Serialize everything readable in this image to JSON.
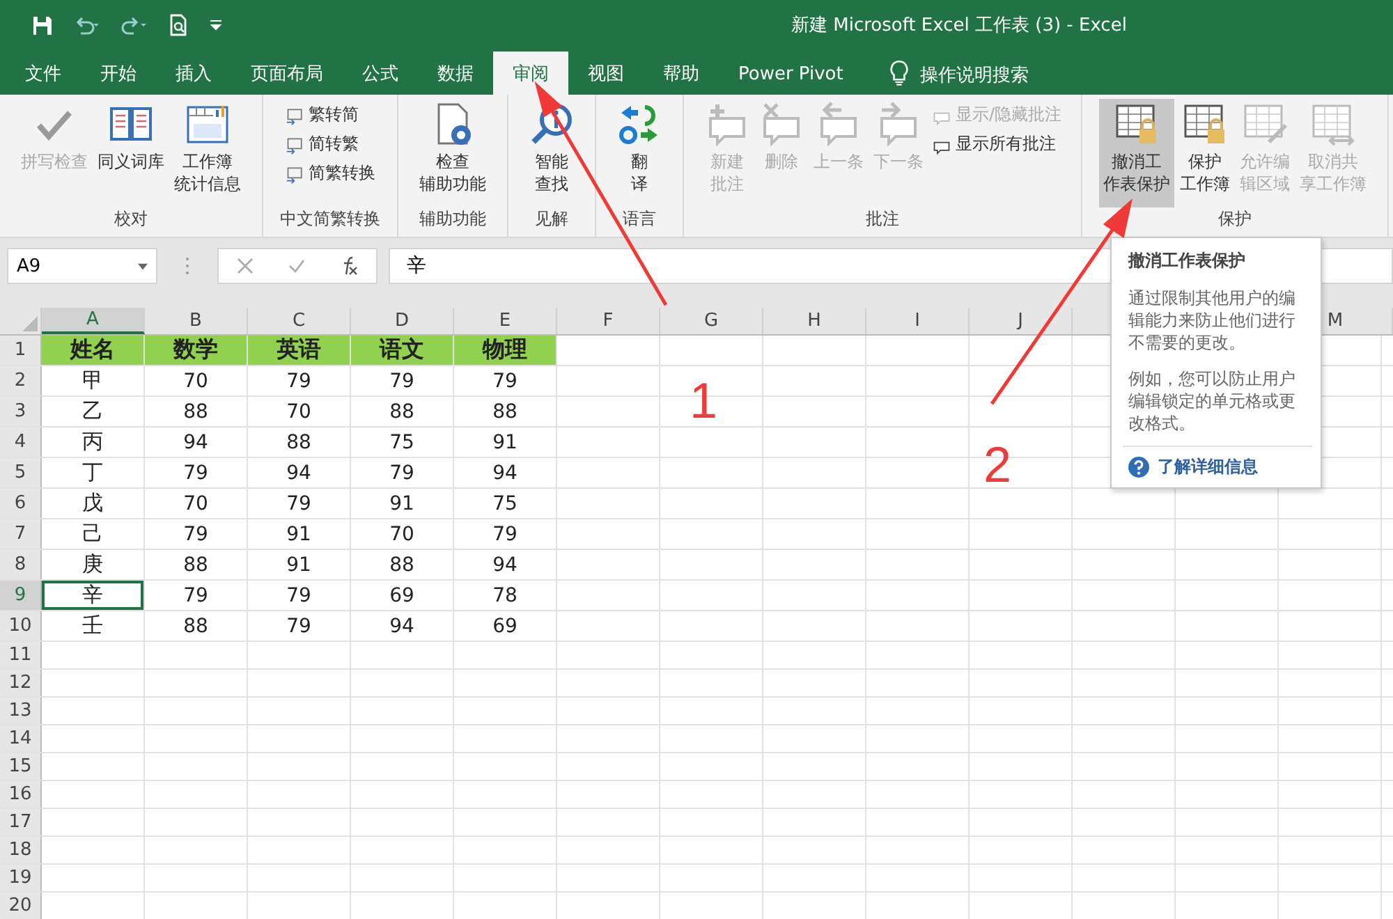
{
  "window": {
    "title": "新建 Microsoft Excel 工作表 (3)  -  Excel"
  },
  "tabs": [
    {
      "label": "文件",
      "selected": false
    },
    {
      "label": "开始",
      "selected": false
    },
    {
      "label": "插入",
      "selected": false
    },
    {
      "label": "页面布局",
      "selected": false
    },
    {
      "label": "公式",
      "selected": false
    },
    {
      "label": "数据",
      "selected": false
    },
    {
      "label": "审阅",
      "selected": true
    },
    {
      "label": "视图",
      "selected": false
    },
    {
      "label": "帮助",
      "selected": false
    },
    {
      "label": "Power Pivot",
      "selected": false
    }
  ],
  "tell_me": {
    "placeholder": "操作说明搜索"
  },
  "ribbon": {
    "groups": [
      {
        "label": "校对",
        "items": [
          {
            "kind": "large",
            "lines": [
              "拼写检查"
            ],
            "disabled": true,
            "highlighted": false
          },
          {
            "kind": "large",
            "lines": [
              "同义词库"
            ],
            "disabled": false,
            "highlighted": false
          },
          {
            "kind": "large",
            "lines": [
              "工作簿",
              "统计信息"
            ],
            "disabled": false,
            "highlighted": false
          }
        ]
      },
      {
        "label": "中文简繁转换",
        "items": [
          {
            "kind": "small",
            "lines": [
              "繁转简"
            ],
            "disabled": false,
            "highlighted": false
          },
          {
            "kind": "small",
            "lines": [
              "简转繁"
            ],
            "disabled": false,
            "highlighted": false
          },
          {
            "kind": "small",
            "lines": [
              "简繁转换"
            ],
            "disabled": false,
            "highlighted": false
          }
        ]
      },
      {
        "label": "辅助功能",
        "items": [
          {
            "kind": "large",
            "lines": [
              "检查",
              "辅助功能"
            ],
            "disabled": false,
            "highlighted": false
          }
        ]
      },
      {
        "label": "见解",
        "items": [
          {
            "kind": "large",
            "lines": [
              "智能",
              "查找"
            ],
            "disabled": false,
            "highlighted": false
          }
        ]
      },
      {
        "label": "语言",
        "items": [
          {
            "kind": "large",
            "lines": [
              "翻",
              "译"
            ],
            "disabled": false,
            "highlighted": false
          }
        ]
      },
      {
        "label": "批注",
        "items": [
          {
            "kind": "large",
            "lines": [
              "新建",
              "批注"
            ],
            "disabled": true,
            "highlighted": false
          },
          {
            "kind": "large",
            "lines": [
              "删除"
            ],
            "disabled": true,
            "highlighted": false
          },
          {
            "kind": "large",
            "lines": [
              "上一条"
            ],
            "disabled": true,
            "highlighted": false
          },
          {
            "kind": "large",
            "lines": [
              "下一条"
            ],
            "disabled": true,
            "highlighted": false
          },
          {
            "kind": "small",
            "lines": [
              "显示/隐藏批注"
            ],
            "disabled": true,
            "highlighted": false
          },
          {
            "kind": "small",
            "lines": [
              "显示所有批注"
            ],
            "disabled": false,
            "highlighted": false
          }
        ]
      },
      {
        "label": "保护",
        "items": [
          {
            "kind": "large",
            "lines": [
              "撤消工",
              "作表保护"
            ],
            "disabled": false,
            "highlighted": true
          },
          {
            "kind": "large",
            "lines": [
              "保护",
              "工作簿"
            ],
            "disabled": false,
            "highlighted": false
          },
          {
            "kind": "large",
            "lines": [
              "允许编",
              "辑区域"
            ],
            "disabled": true,
            "highlighted": false
          },
          {
            "kind": "large",
            "lines": [
              "取消共",
              "享工作簿"
            ],
            "disabled": true,
            "highlighted": false
          }
        ]
      }
    ]
  },
  "formula_bar": {
    "name_box": "A9",
    "value": "辛"
  },
  "sheet": {
    "columns": [
      {
        "label": "A",
        "selected": true
      },
      {
        "label": "B",
        "selected": false
      },
      {
        "label": "C",
        "selected": false
      },
      {
        "label": "D",
        "selected": false
      },
      {
        "label": "E",
        "selected": false
      },
      {
        "label": "F",
        "selected": false
      },
      {
        "label": "G",
        "selected": false
      },
      {
        "label": "H",
        "selected": false
      },
      {
        "label": "I",
        "selected": false
      },
      {
        "label": "J",
        "selected": false
      }
    ],
    "right_columns": [
      {
        "label": "M",
        "selected": false
      }
    ],
    "rows": [
      {
        "header": "1",
        "kind": "header",
        "selected": false,
        "cells": [
          "姓名",
          "数学",
          "英语",
          "语文",
          "物理"
        ]
      },
      {
        "header": "2",
        "kind": "data",
        "selected": false,
        "cells": [
          "甲",
          "70",
          "79",
          "79",
          "79"
        ]
      },
      {
        "header": "3",
        "kind": "data",
        "selected": false,
        "cells": [
          "乙",
          "88",
          "70",
          "88",
          "88"
        ]
      },
      {
        "header": "4",
        "kind": "data",
        "selected": false,
        "cells": [
          "丙",
          "94",
          "88",
          "75",
          "91"
        ]
      },
      {
        "header": "5",
        "kind": "data",
        "selected": false,
        "cells": [
          "丁",
          "79",
          "94",
          "79",
          "94"
        ]
      },
      {
        "header": "6",
        "kind": "data",
        "selected": false,
        "cells": [
          "戊",
          "70",
          "79",
          "91",
          "75"
        ]
      },
      {
        "header": "7",
        "kind": "data",
        "selected": false,
        "cells": [
          "己",
          "79",
          "91",
          "70",
          "79"
        ]
      },
      {
        "header": "8",
        "kind": "data",
        "selected": false,
        "cells": [
          "庚",
          "88",
          "91",
          "88",
          "94"
        ]
      },
      {
        "header": "9",
        "kind": "data",
        "selected": true,
        "cells": [
          "辛",
          "79",
          "79",
          "69",
          "78"
        ]
      },
      {
        "header": "10",
        "kind": "data",
        "selected": false,
        "cells": [
          "壬",
          "88",
          "79",
          "94",
          "69"
        ]
      },
      {
        "header": "11",
        "kind": "empty",
        "selected": false
      },
      {
        "header": "12",
        "kind": "empty",
        "selected": false
      },
      {
        "header": "13",
        "kind": "empty",
        "selected": false
      },
      {
        "header": "14",
        "kind": "empty",
        "selected": false
      },
      {
        "header": "15",
        "kind": "empty",
        "selected": false
      },
      {
        "header": "16",
        "kind": "empty",
        "selected": false
      },
      {
        "header": "17",
        "kind": "empty",
        "selected": false
      },
      {
        "header": "18",
        "kind": "empty",
        "selected": false
      },
      {
        "header": "19",
        "kind": "empty",
        "selected": false
      },
      {
        "header": "20",
        "kind": "empty",
        "selected": false
      }
    ]
  },
  "tooltip": {
    "title": "撤消工作表保护",
    "paragraphs": [
      "通过限制其他用户的编辑能力来防止他们进行不需要的更改。",
      "例如，您可以防止用户编辑锁定的单元格或更改格式。"
    ],
    "link": "了解详细信息"
  },
  "annotations": [
    {
      "label": "1"
    },
    {
      "label": "2"
    }
  ]
}
